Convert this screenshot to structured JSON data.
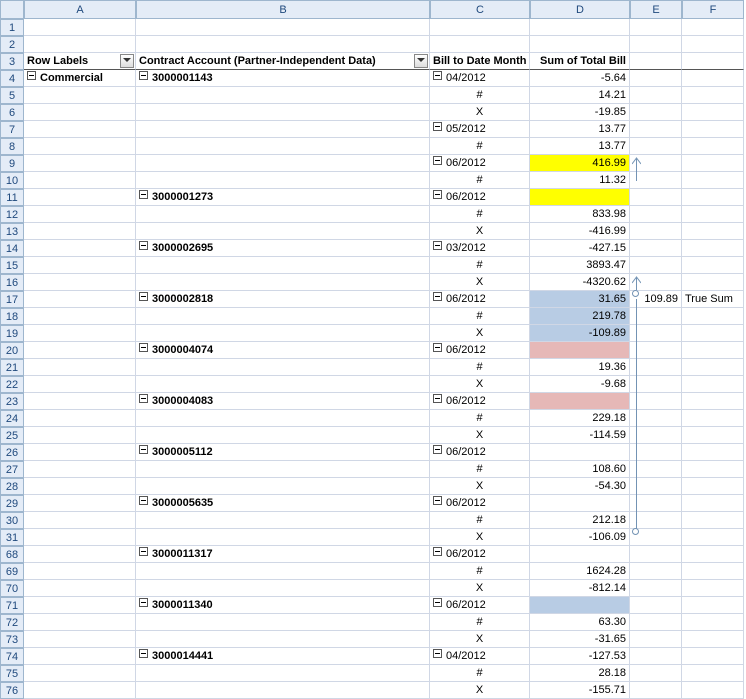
{
  "columns": [
    "",
    "A",
    "B",
    "C",
    "D",
    "E",
    "F"
  ],
  "headers": {
    "rowLabels": "Row Labels",
    "contract": "Contract Account (Partner-Independent Data)",
    "billMonth": "Bill to Date Month",
    "sumTotal": "Sum of Total Bill"
  },
  "rowA": "Commercial",
  "annotation": {
    "value": "109.89",
    "label": "True Sum"
  },
  "rows": [
    {
      "n": "1",
      "b": "",
      "c": "",
      "d": "",
      "e": "",
      "f": ""
    },
    {
      "n": "2",
      "b": "",
      "c": "",
      "d": "",
      "e": "",
      "f": ""
    },
    {
      "n": "3",
      "hdr": true
    },
    {
      "n": "4",
      "b": "3000001143",
      "c": "04/2012",
      "d": "-5.64",
      "btn": true,
      "cbtn": true,
      "aLabel": true
    },
    {
      "n": "5",
      "c": "#",
      "d": "14.21"
    },
    {
      "n": "6",
      "c": "X",
      "d": "-19.85"
    },
    {
      "n": "7",
      "c": "05/2012",
      "d": "13.77",
      "cbtn": true
    },
    {
      "n": "8",
      "c": "#",
      "d": "13.77"
    },
    {
      "n": "9",
      "c": "06/2012",
      "d": "416.99",
      "cbtn": true,
      "hl": "yellow"
    },
    {
      "n": "10",
      "c": "#",
      "d": "11.32"
    },
    {
      "n": "11",
      "b": "3000001273",
      "c": "06/2012",
      "d": "",
      "btn": true,
      "cbtn": true,
      "hl": "yellow"
    },
    {
      "n": "12",
      "c": "#",
      "d": "833.98"
    },
    {
      "n": "13",
      "c": "X",
      "d": "-416.99"
    },
    {
      "n": "14",
      "b": "3000002695",
      "c": "03/2012",
      "d": "-427.15",
      "btn": true,
      "cbtn": true
    },
    {
      "n": "15",
      "c": "#",
      "d": "3893.47"
    },
    {
      "n": "16",
      "c": "X",
      "d": "-4320.62"
    },
    {
      "n": "17",
      "b": "3000002818",
      "c": "06/2012",
      "d": "31.65",
      "btn": true,
      "cbtn": true,
      "hl": "blue",
      "eVal": "109.89",
      "fVal": "True Sum"
    },
    {
      "n": "18",
      "c": "#",
      "d": "219.78",
      "hl": "blue"
    },
    {
      "n": "19",
      "c": "X",
      "d": "-109.89",
      "hl": "blue"
    },
    {
      "n": "20",
      "b": "3000004074",
      "c": "06/2012",
      "d": "",
      "btn": true,
      "cbtn": true,
      "hl": "pink"
    },
    {
      "n": "21",
      "c": "#",
      "d": "19.36"
    },
    {
      "n": "22",
      "c": "X",
      "d": "-9.68"
    },
    {
      "n": "23",
      "b": "3000004083",
      "c": "06/2012",
      "d": "",
      "btn": true,
      "cbtn": true,
      "hl": "pink"
    },
    {
      "n": "24",
      "c": "#",
      "d": "229.18"
    },
    {
      "n": "25",
      "c": "X",
      "d": "-114.59"
    },
    {
      "n": "26",
      "b": "3000005112",
      "c": "06/2012",
      "d": "",
      "btn": true,
      "cbtn": true
    },
    {
      "n": "27",
      "c": "#",
      "d": "108.60"
    },
    {
      "n": "28",
      "c": "X",
      "d": "-54.30"
    },
    {
      "n": "29",
      "b": "3000005635",
      "c": "06/2012",
      "d": "",
      "btn": true,
      "cbtn": true
    },
    {
      "n": "30",
      "c": "#",
      "d": "212.18"
    },
    {
      "n": "31",
      "c": "X",
      "d": "-106.09"
    },
    {
      "n": "68",
      "b": "3000011317",
      "c": "06/2012",
      "d": "",
      "btn": true,
      "cbtn": true
    },
    {
      "n": "69",
      "c": "#",
      "d": "1624.28"
    },
    {
      "n": "70",
      "c": "X",
      "d": "-812.14"
    },
    {
      "n": "71",
      "b": "3000011340",
      "c": "06/2012",
      "d": "",
      "btn": true,
      "cbtn": true,
      "hl": "blue"
    },
    {
      "n": "72",
      "c": "#",
      "d": "63.30"
    },
    {
      "n": "73",
      "c": "X",
      "d": "-31.65"
    },
    {
      "n": "74",
      "b": "3000014441",
      "c": "04/2012",
      "d": "-127.53",
      "btn": true,
      "cbtn": true
    },
    {
      "n": "75",
      "c": "#",
      "d": "28.18"
    },
    {
      "n": "76",
      "c": "X",
      "d": "-155.71"
    }
  ]
}
